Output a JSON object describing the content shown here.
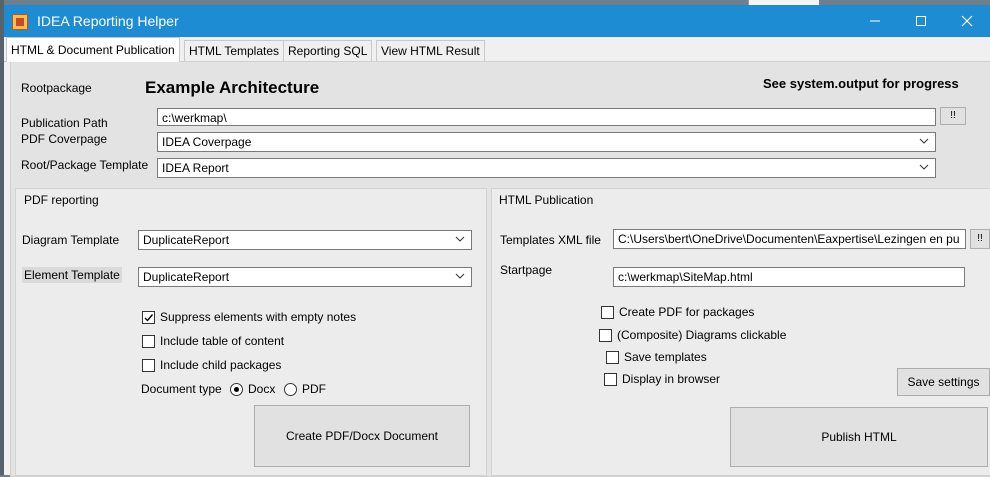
{
  "window": {
    "title": "IDEA Reporting Helper",
    "minimize_label": "—",
    "maximize_label": "☐",
    "close_label": "✕"
  },
  "tabs": [
    {
      "label": "HTML & Document Publication",
      "active": true
    },
    {
      "label": "HTML Templates"
    },
    {
      "label": "Reporting SQL"
    },
    {
      "label": "View HTML Result"
    }
  ],
  "header": {
    "rootpackage_label": "Rootpackage",
    "rootpackage_value": "Example Architecture",
    "progress_note": "See system.output for progress"
  },
  "fields": {
    "publication_path_label": "Publication Path",
    "publication_path_value": "c:\\werkmap\\",
    "browse_label": "!!",
    "pdf_coverpage_label": "PDF Coverpage",
    "pdf_coverpage_value": "IDEA Coverpage",
    "root_template_label": "Root/Package Template",
    "root_template_value": "IDEA Report"
  },
  "pdf": {
    "heading": "PDF reporting",
    "diagram_template_label": "Diagram Template",
    "diagram_template_value": "DuplicateReport",
    "element_template_label": "Element Template",
    "element_template_value": "DuplicateReport",
    "suppress_label": "Suppress elements with empty notes",
    "suppress_checked": true,
    "toc_label": "Include table of content",
    "toc_checked": false,
    "child_label": "Include child packages",
    "child_checked": false,
    "doctype_label": "Document type",
    "docx_label": "Docx",
    "pdf_label": "PDF",
    "create_button": "Create PDF/Docx Document"
  },
  "html": {
    "heading": "HTML Publication",
    "templates_xml_label": "Templates XML file",
    "templates_xml_value": "C:\\Users\\bert\\OneDrive\\Documenten\\Eaxpertise\\Lezingen en pu",
    "browse_label": "!!",
    "startpage_label": "Startpage",
    "startpage_value": "c:\\werkmap\\SiteMap.html",
    "create_pdf_label": "Create PDF for packages",
    "composite_label": "(Composite) Diagrams clickable",
    "save_templates_label": "Save templates",
    "display_browser_label": "Display in browser",
    "save_settings_button": "Save settings",
    "publish_button": "Publish HTML"
  }
}
